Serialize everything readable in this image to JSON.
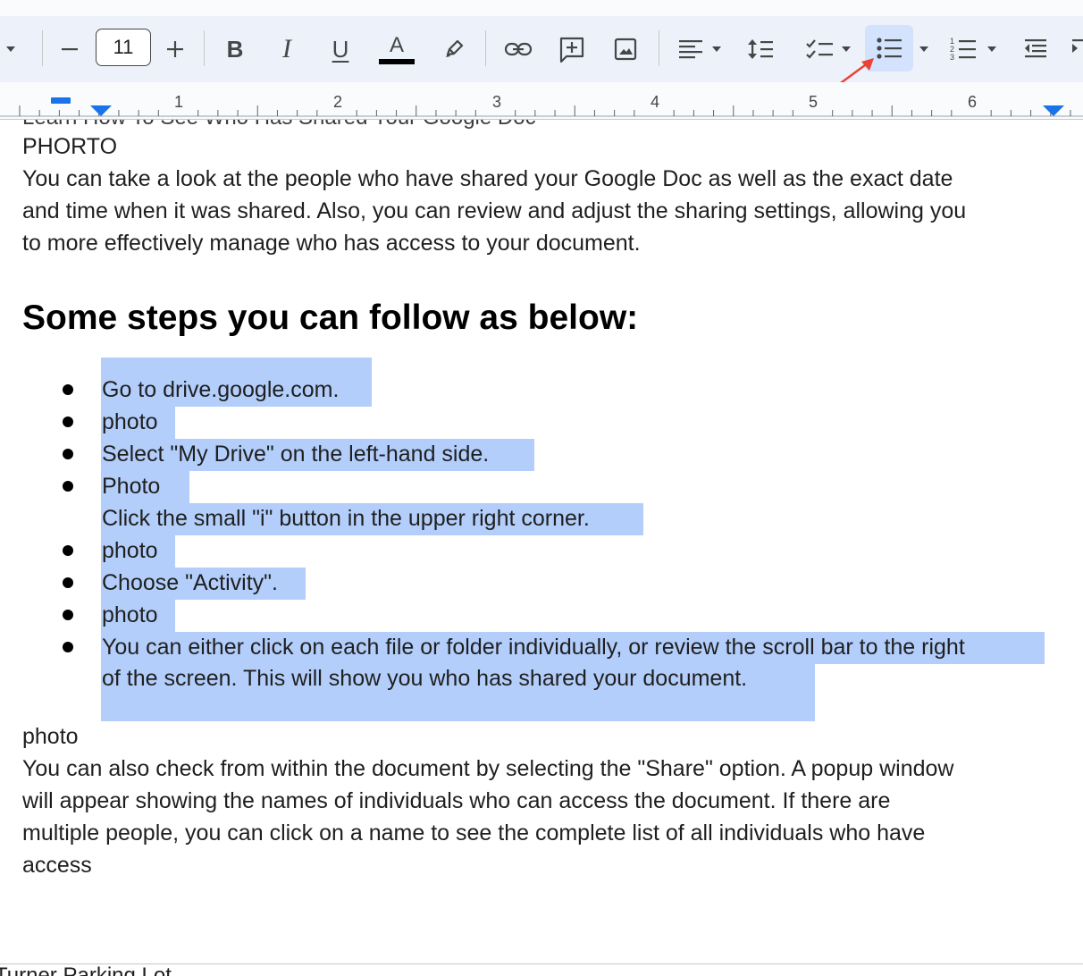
{
  "toolbar": {
    "font_size": "11",
    "text_color_letter": "A",
    "highlight_color": "#000000",
    "active_tool": "bulleted-list"
  },
  "ruler": {
    "numbers": [
      "1",
      "2",
      "3",
      "4",
      "5",
      "6"
    ]
  },
  "document": {
    "clipped_previous_line": "Learn How To See Who Has Shared Your Google Doc",
    "p1": "PHORTO",
    "p2_lines": [
      "You can take a look  at the people who have shared your Google Doc as well as the exact date",
      "and time when it was shared. Also, you can review and adjust the sharing settings, allowing you",
      "to more effectively manage who has access to your document."
    ],
    "heading": "Some steps you can follow as below:",
    "list": [
      {
        "text": "Go to drive.google.com.",
        "bullet": true
      },
      {
        "text": "photo",
        "bullet": true
      },
      {
        "text": "Select \"My Drive\" on the left-hand side.",
        "bullet": true
      },
      {
        "text": "Photo",
        "bullet": true
      },
      {
        "text": "Click the small \"i\" button in the upper right corner.",
        "bullet": false
      },
      {
        "text": "photo",
        "bullet": true
      },
      {
        "text": "Choose \"Activity\".",
        "bullet": true
      },
      {
        "text": "photo",
        "bullet": true
      },
      {
        "text": "You can either click on each file or folder individually, or review the scroll bar to the right",
        "bullet": true
      },
      {
        "text": "of the screen. This will show you who has shared your document.",
        "bullet": false
      }
    ],
    "after_photo": "photo",
    "p3_lines": [
      "You can also check from within the document by selecting the \"Share\" option. A popup window",
      "will appear showing the names of individuals who can access the document. If there are",
      "multiple people, you can click on a name to see the complete list of all individuals who have",
      "access"
    ],
    "next_page_clipped": "Turner Parking Lot"
  },
  "colors": {
    "selection": "#b3cefb",
    "toolbar_bg": "#edf2fa",
    "active_button": "#d3e3fd",
    "arrow": "#ea4335",
    "ruler_marker": "#1a73e8"
  }
}
